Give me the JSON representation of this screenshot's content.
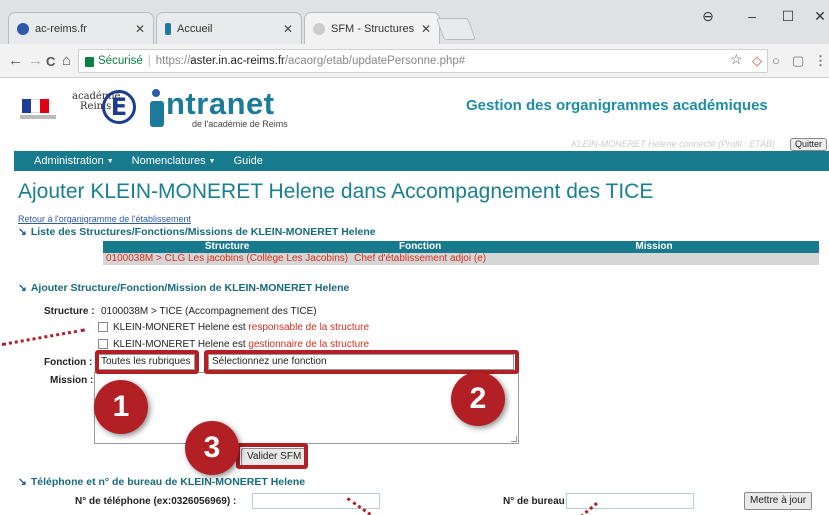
{
  "browser": {
    "tabs": [
      {
        "title": "ac-reims.fr",
        "favicon_color": "#2a5aa8"
      },
      {
        "title": "Accueil",
        "favicon_color": "#1c7b9b"
      },
      {
        "title": "SFM - Structures de KLEI",
        "favicon_color": "#aaaaaa"
      }
    ],
    "secure_label": "Sécurisé",
    "url_scheme": "https://",
    "url_host": "aster.in.ac-reims.fr",
    "url_path": "/acaorg/etab/updatePersonne.php#",
    "window_controls": {
      "account": "⊖",
      "minimize": "–",
      "maximize": "☐",
      "close": "✕"
    },
    "nav": {
      "back": "←",
      "forward": "→",
      "reload": "C",
      "home": "⌂"
    },
    "ext_icons": {
      "star": "☆",
      "ext1": "◇",
      "ext2": "○",
      "ext3": "▢",
      "menu": "⋮"
    }
  },
  "header": {
    "academie_line1": "académie",
    "academie_line2": "Reims",
    "academie_letter": "E",
    "intranet_logo": "ntranet",
    "intranet_sub": "de l'académie de Reims",
    "app_title": "Gestion des organigrammes académiques",
    "user_info": "KLEIN-MONERET Helene connecté (Profil : ETAB)",
    "quit_label": "Quitter"
  },
  "menu": [
    {
      "label": "Administration",
      "caret": true
    },
    {
      "label": "Nomenclatures",
      "caret": true
    },
    {
      "label": "Guide",
      "caret": false
    }
  ],
  "page": {
    "title": "Ajouter KLEIN-MONERET Helene dans Accompagnement des TICE",
    "back_link": "Retour à l'organigramme de l'établissement",
    "list_section": "Liste des Structures/Fonctions/Missions de KLEIN-MONERET Helene",
    "table": {
      "headers": [
        "Structure",
        "Fonction",
        "Mission"
      ],
      "rows": [
        [
          "0100038M > CLG Les jacobins (Collège Les Jacobins)",
          "Chef d'établissement adjoi",
          "(e)",
          ""
        ]
      ]
    },
    "add_section": "Ajouter Structure/Fonction/Mission de KLEIN-MONERET Helene",
    "structure_label": "Structure :",
    "structure_value": "0100038M > TICE (Accompagnement des TICE)",
    "cb1_prefix": "KLEIN-MONERET Helene est ",
    "cb1_suffix": "responsable de la structure",
    "cb2_prefix": "KLEIN-MONERET Helene est ",
    "cb2_suffix": "gestionnaire de la structure",
    "fonction_label": "Fonction :",
    "rubrique_value": "Toutes les rubriques",
    "fonction_value": "Sélectionnez une fonction",
    "mission_label": "Mission :",
    "submit_label": "Valider SFM",
    "phone_section": "Téléphone et n° de bureau de KLEIN-MONERET Helene",
    "phone_label": "N° de téléphone (ex:0326056969) :",
    "office_label": "N° de bureau",
    "update_label": "Mettre à jour"
  },
  "annotations": {
    "badge1": "1",
    "badge2": "2",
    "badge3": "3",
    "color": "#b21f24"
  }
}
